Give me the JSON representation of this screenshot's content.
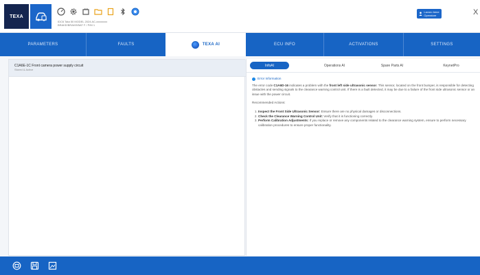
{
  "app": {
    "logo_text": "TEXA",
    "vehicle_info_line1": "IDC6 Tata 50 MODEL 2024 AC-xxxxxxxx",
    "vehicle_info_line2": "BRAKE/BRAKE/BAT F / P/M 1"
  },
  "header": {
    "user_button_line1": "Lavoro bene",
    "user_button_line2": "Operatore",
    "close_label": "X"
  },
  "nav": {
    "tabs": [
      {
        "label": "PARAMETERS"
      },
      {
        "label": "FAULTS"
      },
      {
        "label": "TEXA AI"
      },
      {
        "label": "ECU INFO"
      },
      {
        "label": "ACTIVATIONS"
      },
      {
        "label": "SETTINGS"
      }
    ]
  },
  "left": {
    "item_title": "C1A6E-1C Front camera power supply circuit",
    "item_status": "Stored & Active"
  },
  "right": {
    "subtabs": [
      {
        "label": "InfoAI"
      },
      {
        "label": "Operations AI"
      },
      {
        "label": "Spare Parts AI"
      },
      {
        "label": "KeynetPro"
      }
    ],
    "section_title": "Error Information",
    "p1_a": "The error code ",
    "p1_code": "C1A6D-16",
    "p1_b": " indicates a problem with the ",
    "p1_bold2": "front left side ultrasonic sensor",
    "p1_c": ". This sensor, located on the front bumper, is responsible for detecting obstacles and sending signals to the clearance warning control unit. If there is a fault detected, it may be due to a failure of the front side ultrasonic sensor or an issue with the power circuit.",
    "actions_title": "Recommended Actions:",
    "actions": [
      {
        "title": "Inspect the Front Side Ultrasonic Sensor:",
        "text": " Ensure there are no physical damages or disconnections."
      },
      {
        "title": "Check the Clearance Warning Control Unit:",
        "text": " Verify that it is functioning correctly."
      },
      {
        "title": "Perform Calibration Adjustments:",
        "text": " If you replace or remove any components related to the clearance warning system, ensure to perform necessary calibration procedures to ensure proper functionality."
      }
    ]
  },
  "colors": {
    "brand_blue": "#1764c4",
    "logo_navy": "#14254f"
  }
}
